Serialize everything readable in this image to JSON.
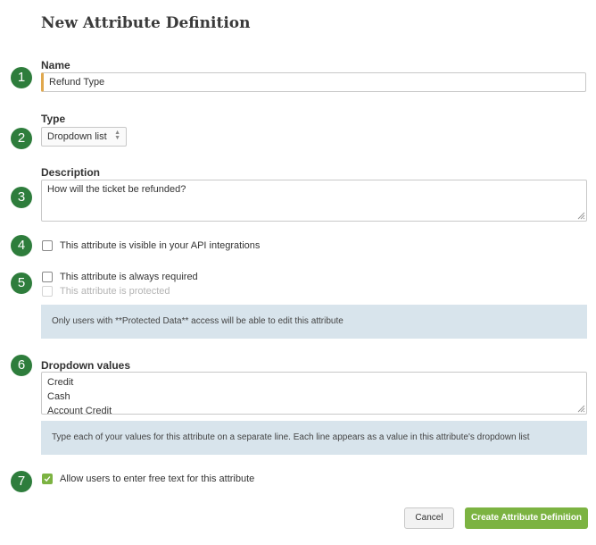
{
  "page": {
    "title": "New Attribute Definition"
  },
  "steps": [
    "1",
    "2",
    "3",
    "4",
    "5",
    "6",
    "7"
  ],
  "name_field": {
    "label": "Name",
    "value": "Refund Type"
  },
  "type_field": {
    "label": "Type",
    "value": "Dropdown list"
  },
  "description_field": {
    "label": "Description",
    "value": "How will the ticket be refunded?"
  },
  "options": {
    "api_visible": {
      "label": "This attribute is visible in your API integrations",
      "checked": false
    },
    "always_required": {
      "label": "This attribute is always required",
      "checked": false
    },
    "protected": {
      "label": "This attribute is protected",
      "checked": false,
      "disabled": true
    },
    "protected_note": "Only users with **Protected Data** access will be able to edit this attribute",
    "free_text": {
      "label": "Allow users to enter free text for this attribute",
      "checked": true
    }
  },
  "dropdown_values": {
    "label": "Dropdown values",
    "values": [
      "Credit",
      "Cash",
      "Account Credit"
    ],
    "help": "Type each of your values for this attribute on a separate line. Each line appears as a value in this attribute's dropdown list"
  },
  "buttons": {
    "cancel": "Cancel",
    "create": "Create Attribute Definition"
  },
  "colors": {
    "badge": "#2e7d3c",
    "accent_green": "#7cb342",
    "info_bg": "#d8e4ec",
    "focus_border": "#e0a84e"
  }
}
